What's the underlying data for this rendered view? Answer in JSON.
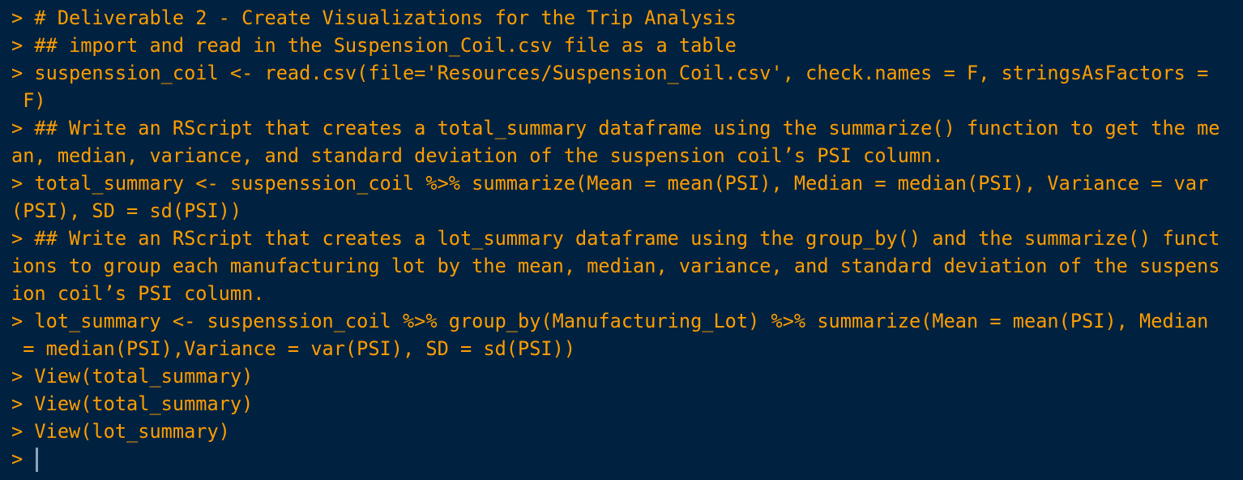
{
  "console": {
    "prompt_symbol": ">",
    "lines": [
      "> # Deliverable 2 - Create Visualizations for the Trip Analysis",
      "> ## import and read in the Suspension_Coil.csv file as a table",
      "> suspenssion_coil <- read.csv(file='Resources/Suspension_Coil.csv', check.names = F, stringsAsFactors =",
      " F)",
      "> ## Write an RScript that creates a total_summary dataframe using the summarize() function to get the me",
      "an, median, variance, and standard deviation of the suspension coil’s PSI column.",
      "> total_summary <- suspenssion_coil %>% summarize(Mean = mean(PSI), Median = median(PSI), Variance = var",
      "(PSI), SD = sd(PSI))",
      "> ## Write an RScript that creates a lot_summary dataframe using the group_by() and the summarize() funct",
      "ions to group each manufacturing lot by the mean, median, variance, and standard deviation of the suspens",
      "ion coil’s PSI column.",
      "> lot_summary <- suspenssion_coil %>% group_by(Manufacturing_Lot) %>% summarize(Mean = mean(PSI), Median",
      " = median(PSI),Variance = var(PSI), SD = sd(PSI))",
      "> View(total_summary)",
      "> View(total_summary)",
      "> View(lot_summary)"
    ]
  },
  "colors": {
    "background": "#002240",
    "text": "#ff9d00",
    "cursor": "#8aa4b8"
  }
}
